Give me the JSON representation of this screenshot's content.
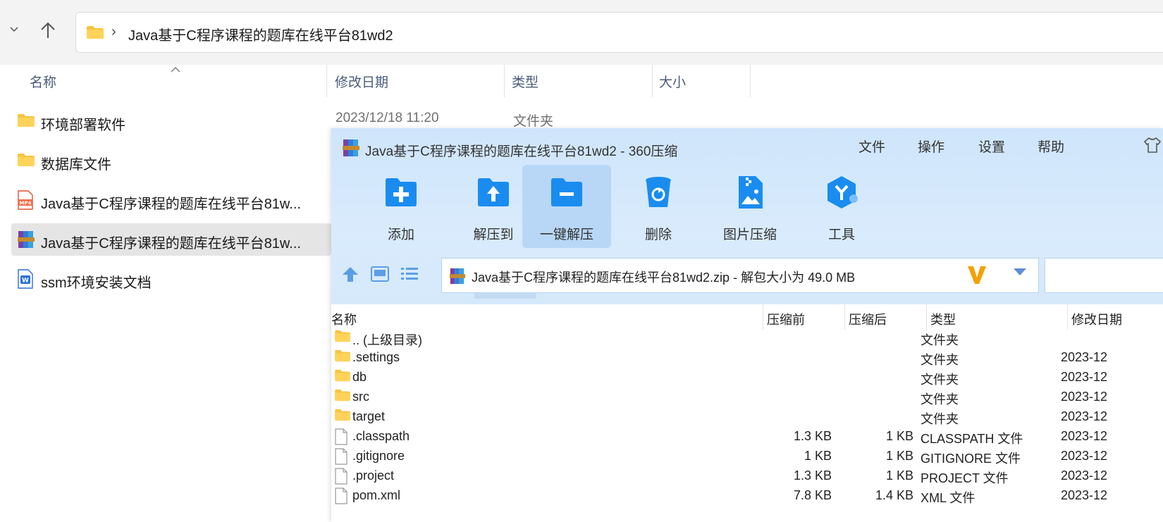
{
  "explorer": {
    "address": {
      "path": "Java基于C程序课程的题库在线平台81wd2",
      "separator": "›"
    },
    "columns": {
      "name": "名称",
      "modified": "修改日期",
      "type": "类型",
      "size": "大小"
    },
    "rows": [
      {
        "name": "环境部署软件",
        "icon": "folder-icon",
        "date": "2023/12/18 11:20",
        "type": "文件夹"
      },
      {
        "name": "数据库文件",
        "icon": "folder-icon"
      },
      {
        "name": "Java基于C程序课程的题库在线平台81w...",
        "icon": "mp4-file-icon"
      },
      {
        "name": "Java基于C程序课程的题库在线平台81w...",
        "icon": "winrar-archive-icon",
        "selected": true
      },
      {
        "name": "ssm环境安装文档",
        "icon": "word-doc-icon"
      }
    ]
  },
  "zip": {
    "title": "Java基于C程序课程的题库在线平台81wd2 - 360压缩",
    "menu": [
      "文件",
      "操作",
      "设置",
      "帮助"
    ],
    "toolbar": [
      "添加",
      "解压到",
      "一键解压",
      "删除",
      "图片压缩",
      "工具"
    ],
    "path_text": "Java基于C程序课程的题库在线平台81wd2.zip - 解包大小为 49.0 MB",
    "columns": {
      "name": "名称",
      "before": "压缩前",
      "after": "压缩后",
      "type": "类型",
      "modified": "修改日期"
    },
    "rows": [
      {
        "name": ".. (上级目录)",
        "icon": "folder-icon",
        "before": "",
        "after": "",
        "type": "文件夹",
        "date": ""
      },
      {
        "name": ".settings",
        "icon": "folder-icon",
        "before": "",
        "after": "",
        "type": "文件夹",
        "date": "2023-12"
      },
      {
        "name": "db",
        "icon": "folder-icon",
        "before": "",
        "after": "",
        "type": "文件夹",
        "date": "2023-12"
      },
      {
        "name": "src",
        "icon": "folder-icon",
        "before": "",
        "after": "",
        "type": "文件夹",
        "date": "2023-12"
      },
      {
        "name": "target",
        "icon": "folder-icon",
        "before": "",
        "after": "",
        "type": "文件夹",
        "date": "2023-12"
      },
      {
        "name": ".classpath",
        "icon": "file-icon",
        "before": "1.3 KB",
        "after": "1 KB",
        "type": "CLASSPATH 文件",
        "date": "2023-12"
      },
      {
        "name": ".gitignore",
        "icon": "file-icon",
        "before": "1 KB",
        "after": "1 KB",
        "type": "GITIGNORE 文件",
        "date": "2023-12"
      },
      {
        "name": ".project",
        "icon": "file-icon",
        "before": "1.3 KB",
        "after": "1 KB",
        "type": "PROJECT 文件",
        "date": "2023-12"
      },
      {
        "name": "pom.xml",
        "icon": "file-icon",
        "before": "7.8 KB",
        "after": "1.4 KB",
        "type": "XML 文件",
        "date": "2023-12"
      }
    ]
  },
  "colors": {
    "accent": "#2b8ef0",
    "header_bg": "#d5e9fb",
    "folder": "#f7c443",
    "selection": "#e5e5e5"
  }
}
